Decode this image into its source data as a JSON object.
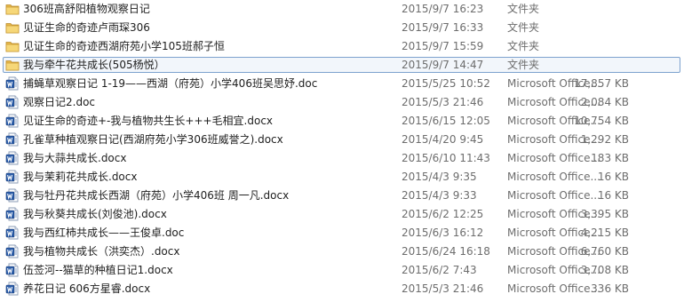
{
  "files": [
    {
      "name": "306班高舒阳植物观察日记",
      "date": "2015/9/7 16:23",
      "type": "文件夹",
      "size": "",
      "icon": "folder-icon",
      "selected": false
    },
    {
      "name": "见证生命的奇迹卢雨琛306",
      "date": "2015/9/7 16:33",
      "type": "文件夹",
      "size": "",
      "icon": "folder-icon",
      "selected": false
    },
    {
      "name": "见证生命的奇迹西湖府苑小学105班郝子恒",
      "date": "2015/9/7 15:59",
      "type": "文件夹",
      "size": "",
      "icon": "folder-icon",
      "selected": false
    },
    {
      "name": "我与牵牛花共成长(505杨悦）",
      "date": "2015/9/7 14:47",
      "type": "文件夹",
      "size": "",
      "icon": "folder-icon",
      "selected": true
    },
    {
      "name": "捕蝇草观察日记  1-19——西湖（府苑）小学406班吴思妤.doc",
      "date": "2015/5/25 10:52",
      "type": "Microsoft Office...",
      "size": "17,857 KB",
      "icon": "word-doc-icon",
      "selected": false
    },
    {
      "name": "观察日记2.doc",
      "date": "2015/5/3 21:46",
      "type": "Microsoft Office...",
      "size": "2,084 KB",
      "icon": "word-doc-icon",
      "selected": false
    },
    {
      "name": "见证生命的奇迹+-我与植物共生长+++毛相宜.docx",
      "date": "2015/6/15 12:05",
      "type": "Microsoft Office...",
      "size": "10,754 KB",
      "icon": "word-doc-icon",
      "selected": false
    },
    {
      "name": "孔雀草种植观察日记(西湖府苑小学306班威誉之).docx",
      "date": "2015/4/20 9:45",
      "type": "Microsoft Office...",
      "size": "1,292 KB",
      "icon": "word-doc-icon",
      "selected": false
    },
    {
      "name": "我与大蒜共成长.docx",
      "date": "2015/6/10 11:43",
      "type": "Microsoft Office...",
      "size": "183 KB",
      "icon": "word-doc-icon",
      "selected": false
    },
    {
      "name": "我与茉莉花共成长.docx",
      "date": "2015/4/3 9:35",
      "type": "Microsoft Office...",
      "size": "16 KB",
      "icon": "word-doc-icon",
      "selected": false
    },
    {
      "name": "我与牡丹花共成长西湖（府苑）小学406班 周一凡.docx",
      "date": "2015/4/3 9:33",
      "type": "Microsoft Office...",
      "size": "16 KB",
      "icon": "word-doc-icon",
      "selected": false
    },
    {
      "name": "我与秋葵共成长(刘俊池).docx",
      "date": "2015/6/2 12:25",
      "type": "Microsoft Office...",
      "size": "3,395 KB",
      "icon": "word-doc-icon",
      "selected": false
    },
    {
      "name": "我与西红柿共成长——王俊卓.doc",
      "date": "2015/6/3 16:12",
      "type": "Microsoft Office...",
      "size": "4,215 KB",
      "icon": "word-doc-icon",
      "selected": false
    },
    {
      "name": "我与植物共成长（洪奕杰）.docx",
      "date": "2015/6/24 16:18",
      "type": "Microsoft Office...",
      "size": "6,760 KB",
      "icon": "word-doc-icon",
      "selected": false
    },
    {
      "name": "伍莶河--猫草的种植日记1.docx",
      "date": "2015/6/2 7:43",
      "type": "Microsoft Office...",
      "size": "3,708 KB",
      "icon": "word-doc-icon",
      "selected": false
    },
    {
      "name": "养花日记 606方星睿.docx",
      "date": "2015/5/3 21:46",
      "type": "Microsoft Office...",
      "size": "336 KB",
      "icon": "word-doc-icon",
      "selected": false
    }
  ]
}
